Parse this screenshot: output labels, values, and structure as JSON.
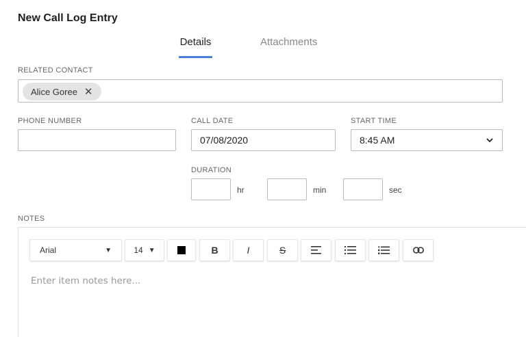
{
  "dialog": {
    "title": "New Call Log Entry"
  },
  "tabs": [
    {
      "label": "Details",
      "active": true
    },
    {
      "label": "Attachments",
      "active": false
    }
  ],
  "related_contact": {
    "label": "RELATED CONTACT",
    "chips": [
      {
        "label": "Alice Goree",
        "remove_icon": "close-icon"
      }
    ]
  },
  "phone_number": {
    "label": "PHONE NUMBER",
    "value": ""
  },
  "call_date": {
    "label": "CALL DATE",
    "value": "07/08/2020"
  },
  "start_time": {
    "label": "START TIME",
    "value": "8:45 AM",
    "icon": "chevron-down-icon"
  },
  "duration": {
    "label": "DURATION",
    "fields": [
      {
        "unit": "hr",
        "value": ""
      },
      {
        "unit": "min",
        "value": ""
      },
      {
        "unit": "sec",
        "value": ""
      }
    ]
  },
  "notes": {
    "label": "NOTES",
    "toolbar": {
      "font": "Arial",
      "size": "14",
      "color": "#000000",
      "bold": "B",
      "italic": "I",
      "strike": "S"
    },
    "placeholder": "Enter item notes here..."
  }
}
